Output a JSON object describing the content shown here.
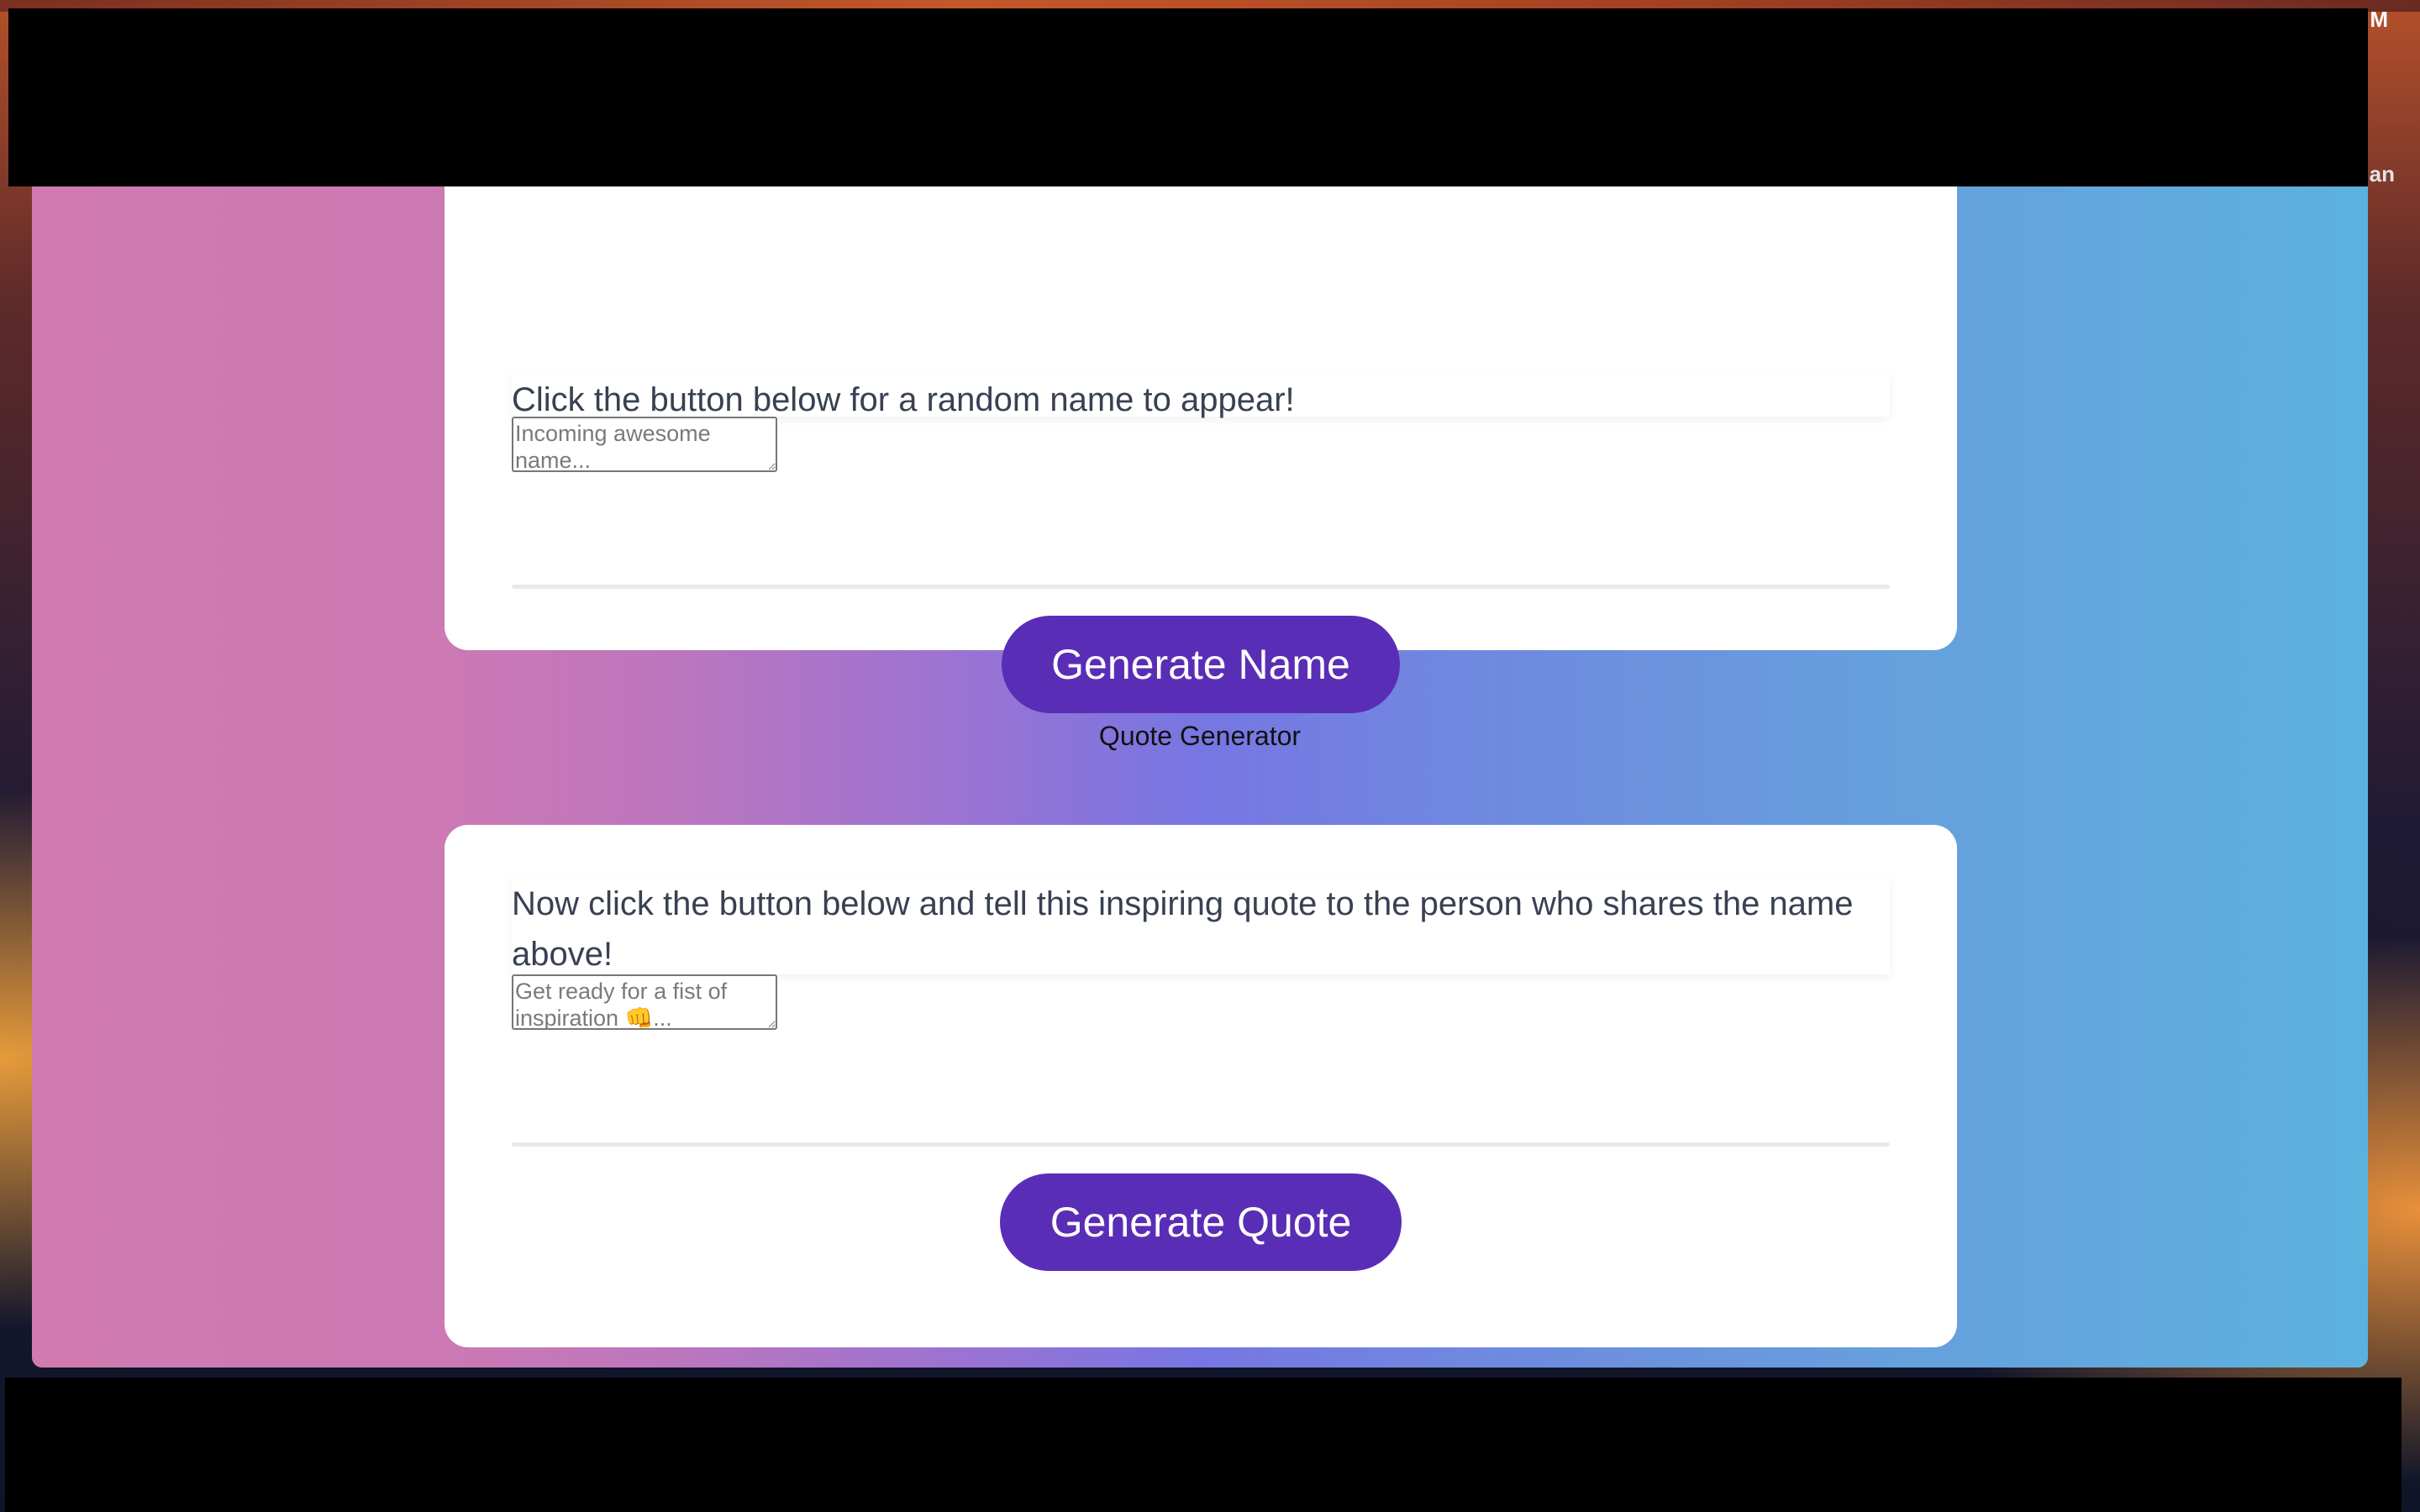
{
  "menubar": {
    "clock_fragment": "M",
    "user_fragment": "an"
  },
  "name_card": {
    "prompt": "Click the button below for a random name to appear!",
    "output_placeholder": "Incoming awesome name...",
    "button_label": "Generate Name"
  },
  "quote_section": {
    "title": "Quote Generator"
  },
  "quote_card": {
    "prompt": "Now click the button below and tell this inspiring quote to the person who shares the name above!",
    "output_placeholder": "Get ready for a fist of inspiration 👊...",
    "button_label": "Generate Quote"
  },
  "colors": {
    "button": "#5a2db7",
    "gradient_left": "#d07ab1",
    "gradient_mid": "#7776e2",
    "gradient_right": "#5cb2de",
    "prompt_text": "#384152"
  }
}
